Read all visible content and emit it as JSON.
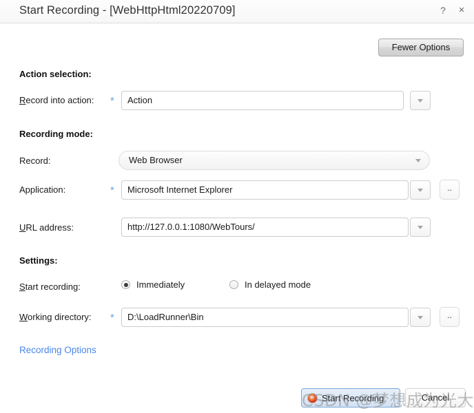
{
  "window": {
    "title": "Start Recording - [WebHttpHtml20220709]",
    "help_icon": "?",
    "close_icon": "×"
  },
  "toolbar": {
    "fewer_options_label": "Fewer Options"
  },
  "sections": {
    "action_selection": {
      "heading": "Action selection:",
      "record_into_action": {
        "label_accel": "R",
        "label_rest": "ecord into action:",
        "required_marker": "*",
        "value": "Action",
        "dropdown_icon": "chevron-down-icon"
      }
    },
    "recording_mode": {
      "heading": "Recording mode:",
      "record": {
        "label": "Record:",
        "value": "Web Browser",
        "dropdown_icon": "chevron-down-icon"
      },
      "application": {
        "label": "Application:",
        "required_marker": "*",
        "value": "Microsoft Internet Explorer",
        "dropdown_icon": "chevron-down-icon",
        "browse_label": ".."
      },
      "url_address": {
        "label_accel": "U",
        "label_rest": "RL address:",
        "value": "http://127.0.0.1:1080/WebTours/",
        "dropdown_icon": "chevron-down-icon"
      }
    },
    "settings": {
      "heading": "Settings:",
      "start_recording": {
        "label_accel": "S",
        "label_rest": "tart recording:",
        "options": [
          {
            "label": "Immediately",
            "selected": true
          },
          {
            "label": "In delayed mode",
            "selected": false
          }
        ]
      },
      "working_directory": {
        "label_accel": "W",
        "label_rest": "orking directory:",
        "required_marker": "*",
        "value": "D:\\LoadRunner\\Bin",
        "dropdown_icon": "chevron-down-icon",
        "browse_label": ".."
      }
    }
  },
  "links": {
    "recording_options": "Recording Options"
  },
  "footer": {
    "start_recording_label": "Start Recording",
    "start_recording_icon": "record-circle-icon",
    "cancel_label": "Cancel"
  },
  "overlay": {
    "watermark": "CSDN @梦想成为光大强！"
  },
  "colors": {
    "required_star": "#6aa3e8",
    "link": "#4a86e8",
    "primary_button_border": "#7aa7d4",
    "record_icon": "#d62a14"
  }
}
